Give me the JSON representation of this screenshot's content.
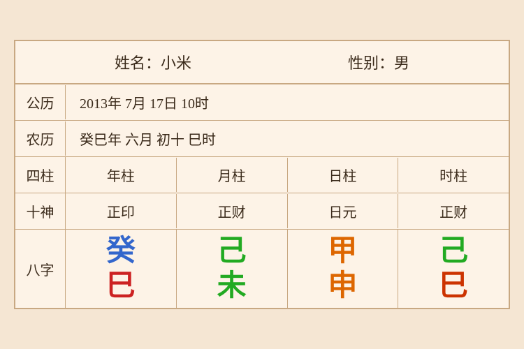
{
  "header": {
    "name_label": "姓名：小米",
    "gender_label": "性别：男"
  },
  "solar": {
    "label": "公历",
    "content": "2013年 7月 17日 10时"
  },
  "lunar": {
    "label": "农历",
    "content": "癸巳年 六月 初十 巳时"
  },
  "table": {
    "header_label": "四柱",
    "headers": [
      "年柱",
      "月柱",
      "日柱",
      "时柱"
    ],
    "shishen_label": "十神",
    "shishen": [
      "正印",
      "正财",
      "日元",
      "正财"
    ],
    "bazi_label": "八字",
    "bazi": [
      {
        "top": "癸",
        "top_color": "blue",
        "bottom": "巳",
        "bottom_color": "red"
      },
      {
        "top": "己",
        "top_color": "green",
        "bottom": "未",
        "bottom_color": "green"
      },
      {
        "top": "甲",
        "top_color": "orange",
        "bottom": "申",
        "bottom_color": "orange"
      },
      {
        "top": "己",
        "top_color": "green2",
        "bottom": "巳",
        "bottom_color": "darkred"
      }
    ]
  }
}
